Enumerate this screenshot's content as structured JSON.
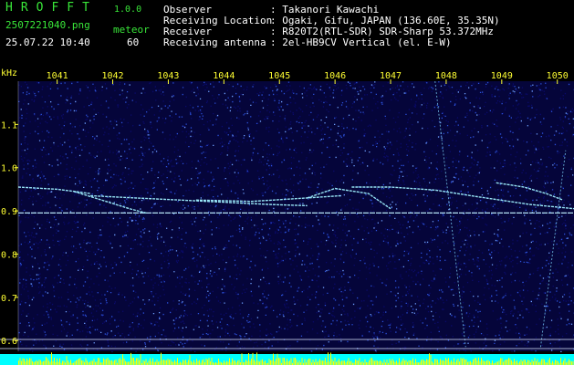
{
  "header": {
    "app_name": "HROFFT",
    "version": "1.0.0",
    "filename": "2507221040.png",
    "datetime": "25.07.22 10:40",
    "mode_label": "meteor",
    "count": "60",
    "info": [
      {
        "label": "Observer",
        "value": ": Takanori Kawachi"
      },
      {
        "label": "Receiving Location",
        "value": ": Ogaki, Gifu, JAPAN (136.60E, 35.35N)"
      },
      {
        "label": "Receiver",
        "value": ": R820T2(RTL-SDR) SDR-Sharp 53.372MHz"
      },
      {
        "label": "Receiving antenna",
        "value": ": 2el-HB9CV Vertical (el. E-W)"
      }
    ]
  },
  "colors": {
    "background": "#000000",
    "noise_low": "#0a0a6a",
    "noise_mid": "#2b4fd8",
    "trace": "#9ff0ff",
    "axis_text": "#ffff33",
    "header_green": "#39e639",
    "bottom_bar": "#00ffff",
    "bottom_yellow": "#ffff00"
  },
  "chart_data": {
    "type": "heatmap",
    "ylabel": "kHz",
    "y_ticks": [
      "1.1",
      "1.0",
      "0.9",
      "0.8",
      "0.7",
      "0.6"
    ],
    "y_tick_values": [
      1.1,
      1.0,
      0.9,
      0.8,
      0.7,
      0.6
    ],
    "ylim": [
      0.575,
      1.2
    ],
    "x_ticks": [
      "1041",
      "1042",
      "1043",
      "1044",
      "1045",
      "1046",
      "1047",
      "1048",
      "1049",
      "1050"
    ],
    "x_tick_values": [
      1041,
      1042,
      1043,
      1044,
      1045,
      1046,
      1047,
      1048,
      1049,
      1050
    ],
    "xlim": [
      1040.3,
      1050.3
    ],
    "carrier_khz": 0.895,
    "traces": [
      {
        "x": [
          1040.3,
          1041.0,
          1042.0,
          1043.0,
          1044.0,
          1045.0,
          1046.0,
          1047.0,
          1048.0,
          1049.0,
          1050.3
        ],
        "y": [
          0.895,
          0.895,
          0.895,
          0.895,
          0.895,
          0.895,
          0.895,
          0.895,
          0.895,
          0.895,
          0.895
        ]
      },
      {
        "x": [
          1040.3,
          1041.0,
          1041.6
        ],
        "y": [
          0.955,
          0.95,
          0.94
        ]
      },
      {
        "x": [
          1041.3,
          1041.8,
          1042.3,
          1042.6
        ],
        "y": [
          0.945,
          0.925,
          0.905,
          0.895
        ]
      },
      {
        "x": [
          1041.6,
          1042.4,
          1043.2,
          1044.0,
          1044.8,
          1045.5
        ],
        "y": [
          0.935,
          0.93,
          0.925,
          0.92,
          0.915,
          0.912
        ]
      },
      {
        "x": [
          1043.5,
          1044.5,
          1045.5,
          1046.1
        ],
        "y": [
          0.925,
          0.922,
          0.93,
          0.935
        ]
      },
      {
        "x": [
          1045.5,
          1046.0,
          1046.6,
          1047.0
        ],
        "y": [
          0.93,
          0.952,
          0.94,
          0.905
        ]
      },
      {
        "x": [
          1046.3,
          1047.0,
          1047.8,
          1048.6,
          1049.5,
          1050.3
        ],
        "y": [
          0.955,
          0.955,
          0.948,
          0.932,
          0.915,
          0.905
        ]
      },
      {
        "x": [
          1048.9,
          1049.4,
          1049.8,
          1050.1
        ],
        "y": [
          0.965,
          0.955,
          0.94,
          0.925
        ]
      }
    ],
    "oblique_lines": [
      {
        "x": [
          1047.8,
          1048.35
        ],
        "y": [
          1.2,
          0.585
        ]
      },
      {
        "x": [
          1049.7,
          1050.15
        ],
        "y": [
          0.585,
          1.04
        ]
      }
    ],
    "grid": false
  }
}
